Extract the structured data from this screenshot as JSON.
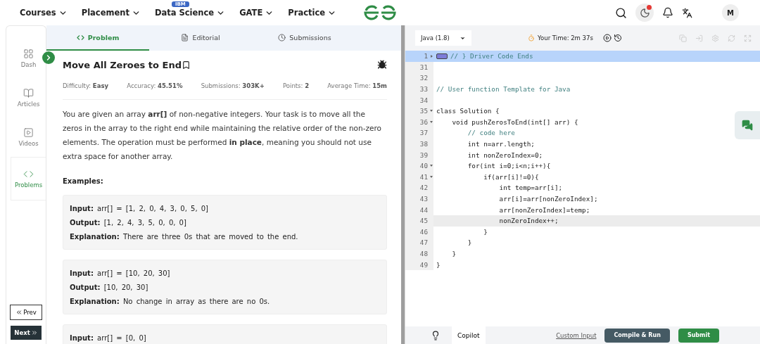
{
  "nav": {
    "items": [
      {
        "label": "Courses"
      },
      {
        "label": "Placement"
      },
      {
        "label": "Data Science",
        "badge": "IBM"
      },
      {
        "label": "GATE"
      },
      {
        "label": "Practice"
      }
    ],
    "notification": true,
    "avatar": "M"
  },
  "sidebar": {
    "items": [
      {
        "label": "Dash",
        "selected": false
      },
      {
        "label": "Articles",
        "selected": false
      },
      {
        "label": "Videos",
        "selected": false
      },
      {
        "label": "Problems",
        "selected": true
      }
    ],
    "prev": "Prev",
    "next": "Next"
  },
  "tabs": [
    {
      "label": "Problem",
      "selected": true
    },
    {
      "label": "Editorial",
      "selected": false
    },
    {
      "label": "Submissions",
      "selected": false
    }
  ],
  "problem": {
    "title": "Move All Zeroes to End",
    "meta": [
      {
        "label": "Difficulty:",
        "value": "Easy"
      },
      {
        "label": "Accuracy:",
        "value": "45.51%"
      },
      {
        "label": "Submissions:",
        "value": "303K+"
      },
      {
        "label": "Points:",
        "value": "2"
      },
      {
        "label": "Average Time:",
        "value": "15m"
      }
    ],
    "description": "You are given an array **arr[]** of non-negative integers. Your task is to move all the zeros in the array to the right end while maintaining the relative order of the non-zero elements. The operation must be performed **in place**, meaning you should not use extra space for another array.",
    "examples_heading": "Examples:",
    "examples": [
      {
        "rows": [
          {
            "label": "Input:",
            "value": "arr[] = [1, 2, 0, 4, 3, 0, 5, 0]"
          },
          {
            "label": "Output:",
            "value": "[1, 2, 4, 3, 5, 0, 0, 0]"
          },
          {
            "label": "Explanation:",
            "value": "There are three 0s that are moved to the end."
          }
        ]
      },
      {
        "rows": [
          {
            "label": "Input:",
            "value": "arr[] = [10, 20, 30]"
          },
          {
            "label": "Output:",
            "value": "[10, 20, 30]"
          },
          {
            "label": "Explanation:",
            "value": "No change in array as there are no 0s."
          }
        ]
      },
      {
        "rows": [
          {
            "label": "Input:",
            "value": "arr[] = [0, 0]"
          }
        ]
      }
    ]
  },
  "editor": {
    "language": "Java (1.8)",
    "timer": "Your Time: 2m 37s",
    "lines": [
      {
        "number": "1",
        "foldable": true,
        "collapsed": true,
        "kind": "comment",
        "text": "// } Driver Code Ends",
        "highlighted": true,
        "active": false
      },
      {
        "number": "31",
        "highlighted": false,
        "active": false
      },
      {
        "number": "32",
        "highlighted": false,
        "active": false
      },
      {
        "number": "33",
        "kind": "comment",
        "text": "// User function Template for Java",
        "highlighted": false,
        "active": false
      },
      {
        "number": "34",
        "highlighted": false,
        "active": false
      },
      {
        "number": "35",
        "foldable": true,
        "collapsed": false,
        "kind": "code",
        "text": "class Solution {",
        "highlighted": false,
        "active": false
      },
      {
        "number": "36",
        "foldable": true,
        "collapsed": false,
        "kind": "code",
        "text": "    void pushZerosToEnd(int[] arr) {",
        "highlighted": false,
        "active": false
      },
      {
        "number": "37",
        "kind": "comment",
        "text": "        // code here",
        "highlighted": false,
        "active": false
      },
      {
        "number": "38",
        "kind": "code",
        "text": "        int n=arr.length;",
        "highlighted": false,
        "active": false
      },
      {
        "number": "39",
        "kind": "code",
        "text": "        int nonZeroIndex=0;",
        "highlighted": false,
        "active": false
      },
      {
        "number": "40",
        "foldable": true,
        "collapsed": false,
        "kind": "code",
        "text": "        for(int i=0;i<n;i++){",
        "highlighted": false,
        "active": false
      },
      {
        "number": "41",
        "foldable": true,
        "collapsed": false,
        "kind": "code",
        "text": "            if(arr[i]!=0){",
        "highlighted": false,
        "active": false
      },
      {
        "number": "42",
        "kind": "code",
        "text": "                int temp=arr[i];",
        "highlighted": false,
        "active": false
      },
      {
        "number": "43",
        "kind": "code",
        "text": "                arr[i]=arr[nonZeroIndex];",
        "highlighted": false,
        "active": false
      },
      {
        "number": "44",
        "kind": "code",
        "text": "                arr[nonZeroIndex]=temp;",
        "highlighted": false,
        "active": false
      },
      {
        "number": "45",
        "kind": "code",
        "text": "                nonZeroIndex++;",
        "highlighted": false,
        "active": true
      },
      {
        "number": "46",
        "kind": "code",
        "text": "            }",
        "highlighted": false,
        "active": false
      },
      {
        "number": "47",
        "kind": "code",
        "text": "        }",
        "highlighted": false,
        "active": false
      },
      {
        "number": "48",
        "kind": "code",
        "text": "    }",
        "highlighted": false,
        "active": false
      },
      {
        "number": "49",
        "kind": "code",
        "text": "}",
        "highlighted": false,
        "active": false
      }
    ],
    "copilot": "Copilot",
    "custom_input": "Custom Input",
    "compile": "Compile & Run",
    "submit": "Submit"
  }
}
